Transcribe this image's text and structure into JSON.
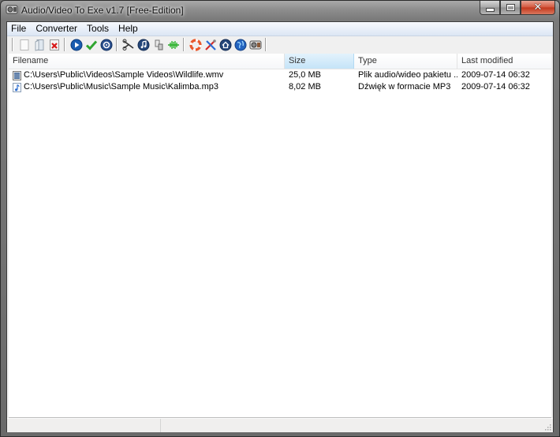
{
  "window": {
    "title": "Audio/Video To Exe v1.7 [Free-Edition]",
    "app_icon": "film-reel-icon",
    "controls": {
      "minimize": "minimize",
      "maximize": "maximize",
      "close": "✕"
    }
  },
  "menu": {
    "items": [
      {
        "label": "File"
      },
      {
        "label": "Converter"
      },
      {
        "label": "Tools"
      },
      {
        "label": "Help"
      }
    ]
  },
  "toolbar": {
    "groups": [
      [
        "new-icon",
        "open-file-icon",
        "delete-icon"
      ],
      [
        "play-icon",
        "check-icon",
        "settings-disc-icon"
      ],
      [
        "cut-icon",
        "music-note-icon",
        "device-icon",
        "waveform-icon"
      ],
      [
        "help-lifebuoy-icon",
        "tools-icon",
        "home-icon",
        "globe-icon",
        "film-reel-icon"
      ]
    ]
  },
  "list": {
    "columns": [
      {
        "label": "Filename"
      },
      {
        "label": "Size",
        "sorted": true
      },
      {
        "label": "Type"
      },
      {
        "label": "Last modified"
      }
    ],
    "rows": [
      {
        "icon": "video-file-icon",
        "filename": "C:\\Users\\Public\\Videos\\Sample Videos\\Wildlife.wmv",
        "size": "25,0 MB",
        "type": "Plik audio/wideo pakietu ...",
        "modified": "2009-07-14 06:32"
      },
      {
        "icon": "audio-file-icon",
        "filename": "C:\\Users\\Public\\Music\\Sample Music\\Kalimba.mp3",
        "size": "8,02 MB",
        "type": "Dźwięk w formacie MP3",
        "modified": "2009-07-14 06:32"
      }
    ]
  },
  "statusbar": {
    "panel1": "",
    "panel2": ""
  },
  "colors": {
    "sorted_header": "#c5e4f8",
    "close_button": "#c2371c",
    "menubar": "#dce6f4"
  }
}
